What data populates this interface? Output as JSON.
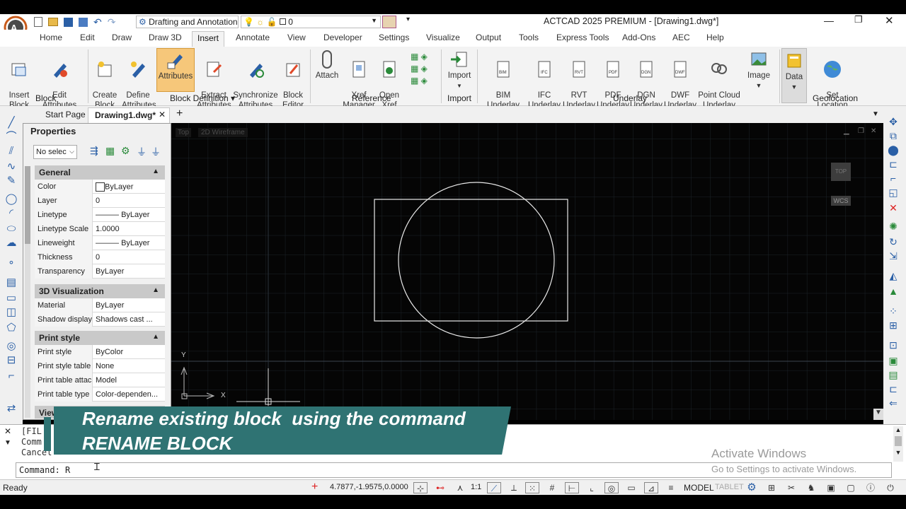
{
  "app": {
    "title": "ACTCAD 2025 PREMIUM - [Drawing1.dwg*]",
    "workspace": "Drafting and Annotation",
    "layer_value": "0"
  },
  "ribbon_tabs": [
    "Home",
    "Edit",
    "Draw",
    "Draw 3D",
    "Insert",
    "Annotate",
    "View",
    "Developer",
    "Settings",
    "Visualize",
    "Output",
    "Tools",
    "Express Tools",
    "Add-Ons",
    "AEC",
    "Help"
  ],
  "ribbon": {
    "block_group": "Block",
    "insert_block": "Insert\nBlock",
    "edit_attributes": "Edit\nAttributes",
    "block_definition_group": "Block Definition",
    "create_block": "Create\nBlock",
    "define_attributes": "Define\nAttributes",
    "attributes": "Attributes",
    "extract_attributes": "Extract\nAttributes",
    "synchronize_attributes": "Synchronize\nAttributes",
    "block_editor": "Block\nEditor",
    "reference_group": "Reference",
    "attach": "Attach",
    "xref_manager": "Xref\nManager",
    "open_xref": "Open\nXref",
    "import_group": "Import",
    "import": "Import",
    "underlay_group": "Underlay",
    "bim_underlay": "BIM\nUnderlay",
    "ifc_underlay": "IFC\nUnderlay",
    "rvt_underlay": "RVT\nUnderlay",
    "pdf_underlay": "PDF\nUnderlay",
    "dgn_underlay": "DGN\nUnderlay",
    "dwf_underlay": "DWF\nUnderlay",
    "point_cloud_underlay": "Point Cloud\nUnderlay",
    "image": "Image",
    "data": "Data",
    "set_location": "Set\nLocation",
    "geolocation_group": "Geolocation"
  },
  "doc_tabs": {
    "start_page": "Start Page",
    "drawing": "Drawing1.dwg*"
  },
  "properties": {
    "title": "Properties",
    "selection": "No selec",
    "sections": [
      {
        "name": "General",
        "rows": [
          {
            "k": "Color",
            "v": "ByLayer"
          },
          {
            "k": "Layer",
            "v": "0"
          },
          {
            "k": "Linetype",
            "v": "ByLayer"
          },
          {
            "k": "Linetype Scale",
            "v": "1.0000"
          },
          {
            "k": "Lineweight",
            "v": "ByLayer"
          },
          {
            "k": "Thickness",
            "v": "0"
          },
          {
            "k": "Transparency",
            "v": "ByLayer"
          }
        ]
      },
      {
        "name": "3D Visualization",
        "rows": [
          {
            "k": "Material",
            "v": "ByLayer"
          },
          {
            "k": "Shadow display",
            "v": "Shadows cast ..."
          }
        ]
      },
      {
        "name": "Print style",
        "rows": [
          {
            "k": "Print style",
            "v": "ByColor"
          },
          {
            "k": "Print style table",
            "v": "None"
          },
          {
            "k": "Print table attac...",
            "v": "Model"
          },
          {
            "k": "Print table type",
            "v": "Color-dependen..."
          }
        ]
      }
    ],
    "next_section": "View"
  },
  "viewport": {
    "view_label": "Top",
    "visual_style": "2D Wireframe",
    "viewcube_label": "TOP",
    "wcs_label": "WCS",
    "y_label": "Y",
    "x_label": "X"
  },
  "banner": {
    "line1": "Rename existing block  using the command",
    "line2": "RENAME BLOCK"
  },
  "command_history": [
    "[FIL",
    "Comm",
    "Cancel"
  ],
  "command_line": {
    "prompt": "Command:",
    "value": "R"
  },
  "watermark": {
    "title": "Activate Windows",
    "sub": "Go to Settings to activate Windows."
  },
  "status": {
    "ready": "Ready",
    "coords": "4.7877,-1.9575,0.0000",
    "scale": "1:1",
    "model": "MODEL",
    "tablet": "TABLET"
  },
  "colors": {
    "canvas": "#050505",
    "banner": "#2f7373",
    "attributes_highlight": "#f6c77a"
  }
}
